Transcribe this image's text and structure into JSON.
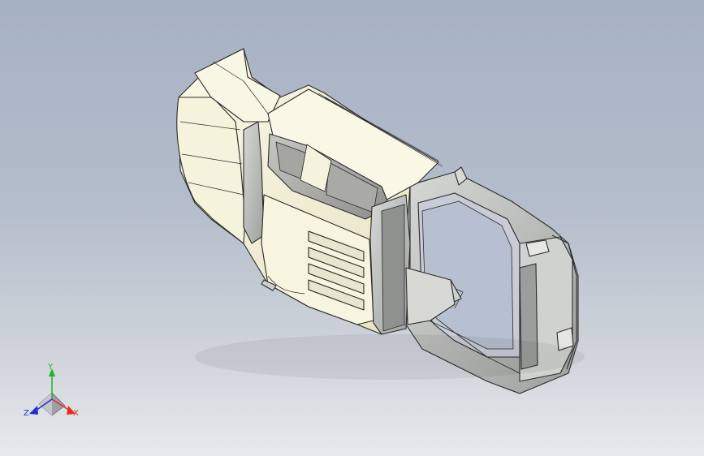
{
  "triad": {
    "x_label": "X",
    "y_label": "Y",
    "z_label": "Z",
    "x_color": "#e03020",
    "y_color": "#20b030",
    "z_color": "#2030d0"
  },
  "scene": {
    "background_top": "#a6b1c3",
    "background_bottom": "#e8e9ec",
    "shell_color": "#f3f0d6",
    "glass_color": "#9a9a98",
    "inner_color": "#b8bab8",
    "edge_color": "#2a2a2a"
  }
}
